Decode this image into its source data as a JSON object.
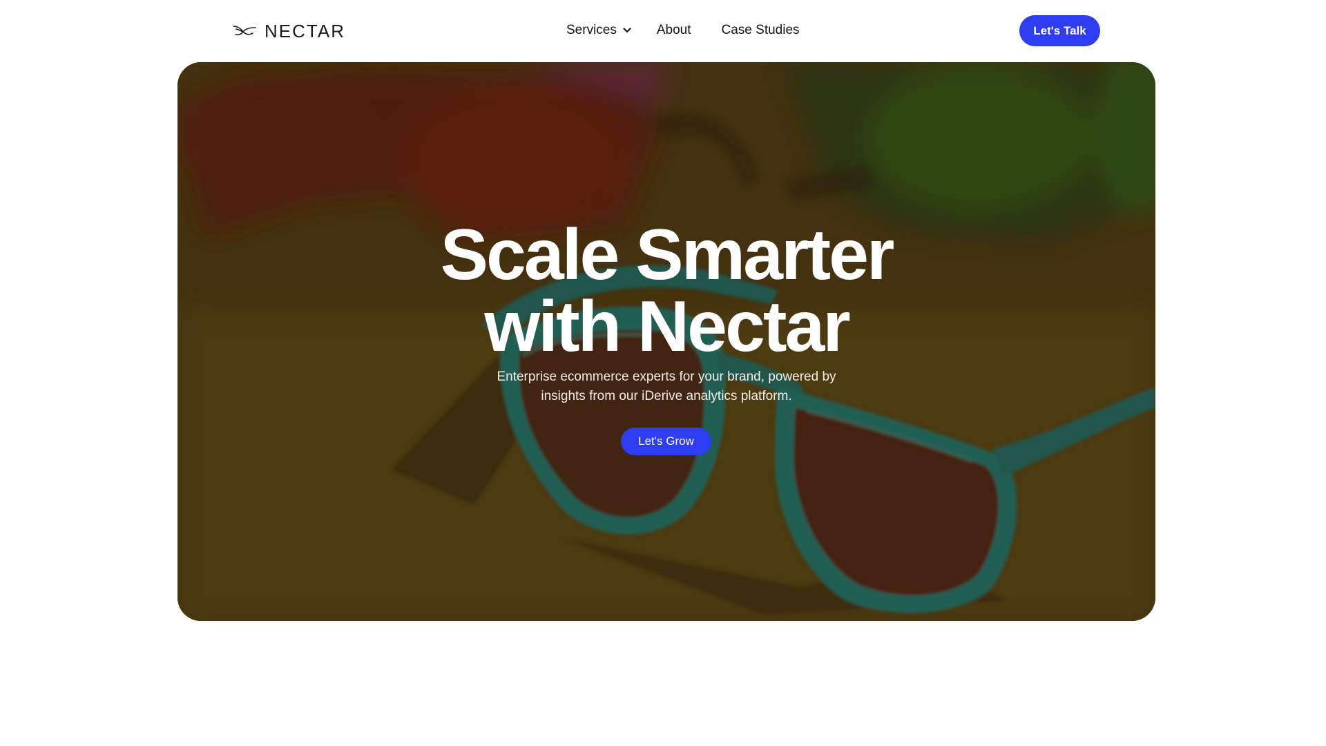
{
  "brand": {
    "name": "NECTAR",
    "logo_icon": "hummingbird-icon"
  },
  "nav": {
    "items": [
      {
        "label": "Services",
        "has_dropdown": true
      },
      {
        "label": "About"
      },
      {
        "label": "Case Studies"
      }
    ]
  },
  "header_cta": {
    "label": "Let's Talk"
  },
  "hero": {
    "title_line1": "Scale Smarter",
    "title_line2": "with Nectar",
    "subtitle_line1": "Enterprise ecommerce experts for your brand, powered by",
    "subtitle_line2": "insights from our iDerive analytics platform.",
    "cta_label": "Let's Grow",
    "background": "sunglasses-photo"
  },
  "colors": {
    "accent": "#2e3df2",
    "text_dark": "#141414",
    "hero_text": "#ffffff"
  }
}
